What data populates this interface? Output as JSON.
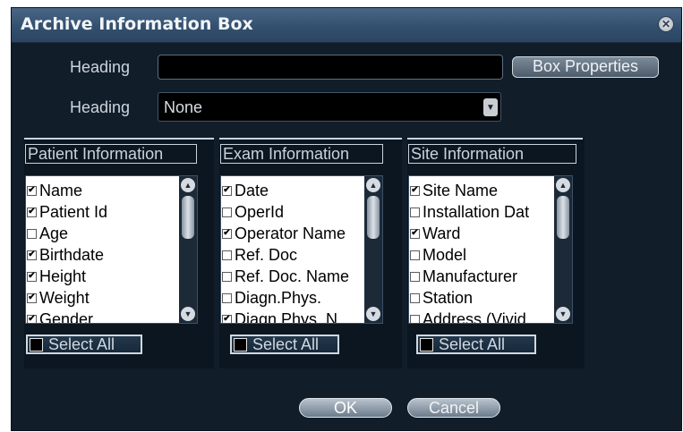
{
  "dialog": {
    "title": "Archive Information Box",
    "close_icon": "close-icon"
  },
  "heading1": {
    "label": "Heading",
    "value": "",
    "button": "Box Properties"
  },
  "heading2": {
    "label": "Heading",
    "selected": "None"
  },
  "panels": [
    {
      "title": "Patient Information",
      "items": [
        {
          "label": "Name",
          "checked": true
        },
        {
          "label": "Patient Id",
          "checked": true
        },
        {
          "label": "Age",
          "checked": false
        },
        {
          "label": "Birthdate",
          "checked": true
        },
        {
          "label": "Height",
          "checked": true
        },
        {
          "label": "Weight",
          "checked": true
        },
        {
          "label": "Gender",
          "checked": true
        }
      ],
      "select_all": "Select All"
    },
    {
      "title": "Exam Information",
      "items": [
        {
          "label": "Date",
          "checked": true
        },
        {
          "label": "OperId",
          "checked": false
        },
        {
          "label": "Operator Name",
          "checked": true
        },
        {
          "label": "Ref. Doc",
          "checked": false
        },
        {
          "label": "Ref. Doc. Name",
          "checked": false
        },
        {
          "label": "Diagn.Phys.",
          "checked": false
        },
        {
          "label": "Diagn.Phys. N",
          "checked": true
        }
      ],
      "select_all": "Select All"
    },
    {
      "title": "Site Information",
      "items": [
        {
          "label": "Site Name",
          "checked": true
        },
        {
          "label": "Installation Dat",
          "checked": false
        },
        {
          "label": "Ward",
          "checked": true
        },
        {
          "label": "Model",
          "checked": false
        },
        {
          "label": "Manufacturer",
          "checked": false
        },
        {
          "label": "Station",
          "checked": false
        },
        {
          "label": "Address (Vivid",
          "checked": false
        }
      ],
      "select_all": "Select All"
    }
  ],
  "footer": {
    "ok": "OK",
    "cancel": "Cancel"
  }
}
